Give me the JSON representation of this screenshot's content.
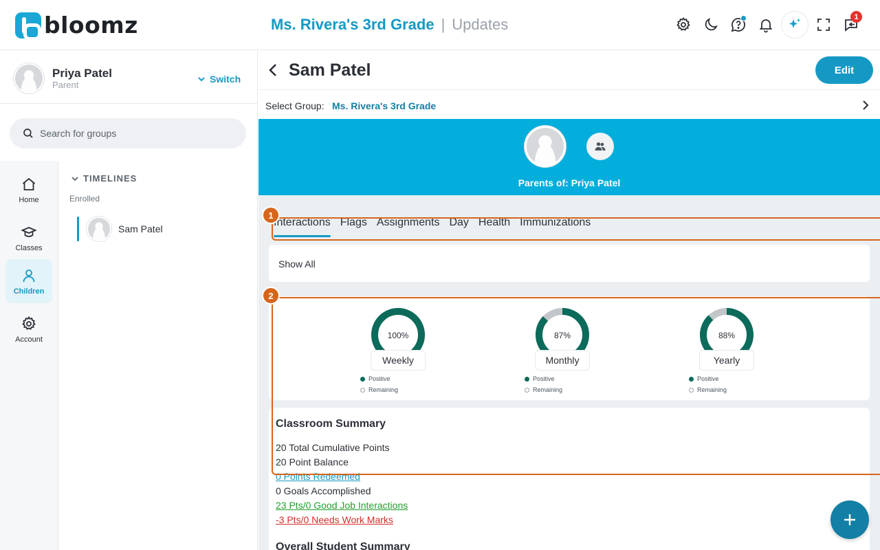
{
  "app": {
    "logo_text": "bloomz"
  },
  "header": {
    "group_name": "Ms. Rivera's 3rd Grade",
    "separator": "|",
    "section": "Updates",
    "notification_count": "1",
    "icons": [
      "gear-icon",
      "moon-icon",
      "help-chat-icon",
      "bell-icon",
      "sparkle-icon",
      "fullscreen-icon",
      "inbox-icon"
    ]
  },
  "user": {
    "name": "Priya Patel",
    "role": "Parent",
    "switch_label": "Switch"
  },
  "search": {
    "placeholder": "Search for groups"
  },
  "nav": {
    "items": [
      {
        "label": "Home",
        "icon": "home-icon"
      },
      {
        "label": "Classes",
        "icon": "graduation-cap-icon"
      },
      {
        "label": "Children",
        "icon": "person-icon",
        "active": true
      },
      {
        "label": "Account",
        "icon": "gear-icon"
      }
    ]
  },
  "timelines": {
    "heading": "TIMELINES",
    "enrolled_label": "Enrolled",
    "children": [
      {
        "name": "Sam Patel"
      }
    ]
  },
  "student": {
    "name": "Sam Patel",
    "edit_label": "Edit",
    "select_group_label": "Select Group:",
    "select_group_value": "Ms. Rivera's 3rd Grade",
    "parents_label": "Parents of: Priya Patel"
  },
  "tabs": [
    {
      "label": "Interactions",
      "active": true
    },
    {
      "label": "Flags"
    },
    {
      "label": "Assignments"
    },
    {
      "label": "Day"
    },
    {
      "label": "Health"
    },
    {
      "label": "Immunizations"
    }
  ],
  "filter": {
    "label": "Show All"
  },
  "gauges": [
    {
      "period": "Weekly",
      "percent_text": "100%",
      "positive": 100
    },
    {
      "period": "Monthly",
      "percent_text": "87%",
      "positive": 87
    },
    {
      "period": "Yearly",
      "percent_text": "88%",
      "positive": 88
    }
  ],
  "gauge_legend": {
    "positive": "Positive",
    "remaining": "Remaining"
  },
  "colors": {
    "positive": "#0c6b5a",
    "remaining": "#c3c6c9",
    "accent": "#1599c4",
    "banner": "#04aedc",
    "highlight": "#d6661c"
  },
  "summary": {
    "title": "Classroom Summary",
    "total_points": "20 Total Cumulative Points",
    "balance": "20 Point Balance",
    "redeemed": "0 Points Redeemed",
    "goals": "0 Goals Accomplished",
    "good_job": "23 Pts/0 Good Job Interactions",
    "needs_work": "-3 Pts/0 Needs Work Marks",
    "next_title": "Overall Student Summary"
  },
  "annotations": {
    "first": "1",
    "second": "2"
  }
}
